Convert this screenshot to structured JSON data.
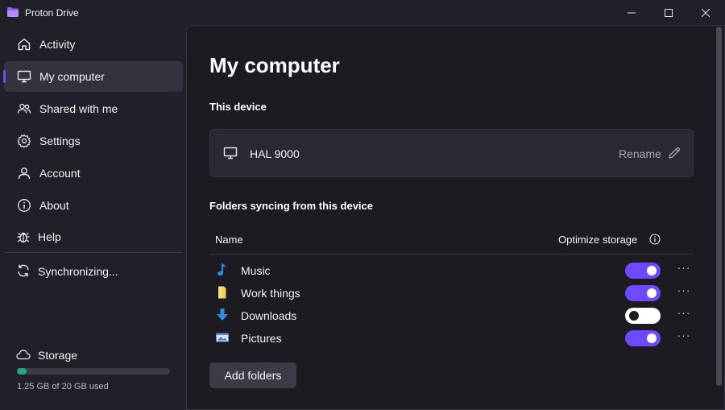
{
  "window": {
    "title": "Proton Drive"
  },
  "sidebar": {
    "items": [
      {
        "label": "Activity",
        "icon": "home-icon"
      },
      {
        "label": "My computer",
        "icon": "monitor-icon",
        "active": true
      },
      {
        "label": "Shared with me",
        "icon": "users-icon"
      },
      {
        "label": "Settings",
        "icon": "gear-icon"
      },
      {
        "label": "Account",
        "icon": "user-icon"
      },
      {
        "label": "About",
        "icon": "info-icon"
      },
      {
        "label": "Help",
        "icon": "bug-icon"
      }
    ],
    "sync_status": "Synchronizing...",
    "storage": {
      "label": "Storage",
      "used_text": "1.25 GB of 20 GB used",
      "used_fraction": 0.0625
    }
  },
  "main": {
    "title": "My computer",
    "this_device_heading": "This device",
    "device": {
      "name": "HAL 9000",
      "rename_label": "Rename"
    },
    "folders_heading": "Folders syncing from this device",
    "columns": {
      "name": "Name",
      "optimize": "Optimize storage"
    },
    "folders": [
      {
        "name": "Music",
        "icon": "music-note-icon",
        "optimize": true
      },
      {
        "name": "Work things",
        "icon": "folder-icon",
        "optimize": true
      },
      {
        "name": "Downloads",
        "icon": "download-arrow-icon",
        "optimize": false
      },
      {
        "name": "Pictures",
        "icon": "picture-icon",
        "optimize": true
      }
    ],
    "more_label": "···",
    "add_button": "Add folders"
  },
  "colors": {
    "accent": "#6d4aff",
    "storage_fill": "#1ea885",
    "background": "#202028",
    "panel": "#1b1b21"
  }
}
